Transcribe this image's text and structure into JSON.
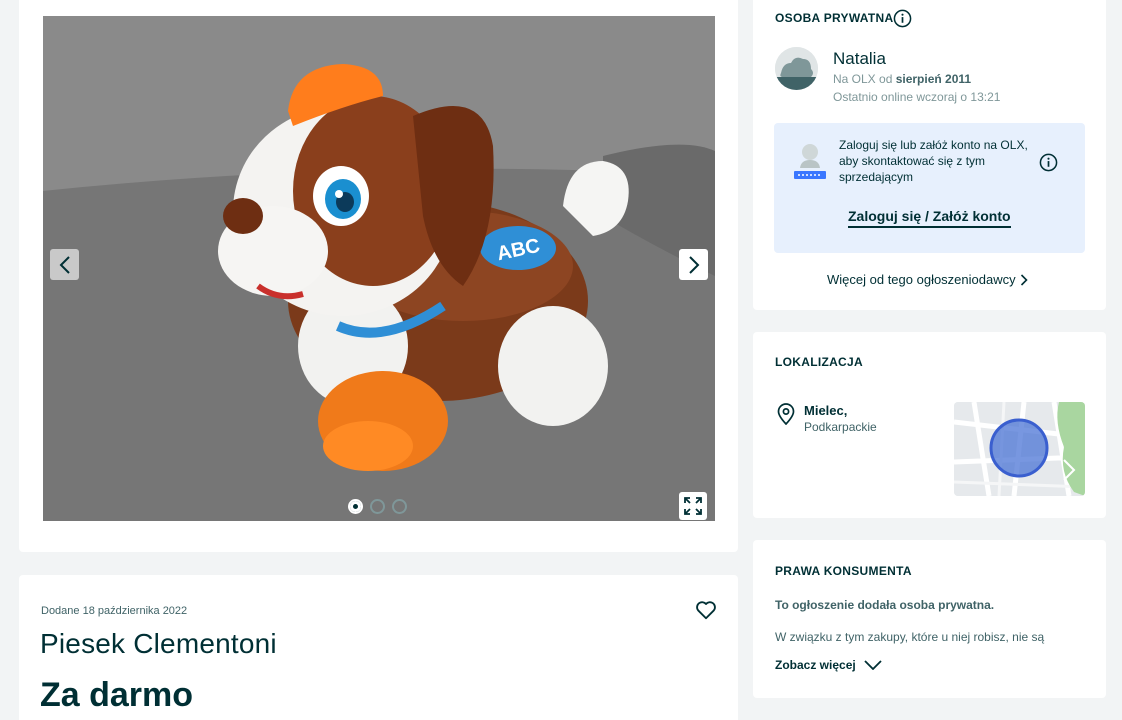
{
  "gallery": {
    "image_alt": "toy-dog-photo",
    "slide_count": 3,
    "active_slide": 1,
    "photo_badge_text": "ABC",
    "icons": {
      "prev": "chevron-left-icon",
      "next": "chevron-right-icon",
      "fullscreen": "expand-icon"
    }
  },
  "ad": {
    "added_date": "Dodane 18 października 2022",
    "title": "Piesek Clementoni",
    "price": "Za darmo",
    "favorite_icon": "heart-outline-icon"
  },
  "seller": {
    "heading": "OSOBA PRYWATNA",
    "name": "Natalia",
    "since_prefix": "Na OLX od ",
    "since_value": "sierpień 2011",
    "last_online": "Ostatnio online wczoraj o 13:21",
    "login_prompt": "Zaloguj się lub załóż konto na OLX, aby skontaktować się z tym sprzedającym",
    "login_link": "Zaloguj się / Załóż konto",
    "more_from_seller": "Więcej od tego ogłoszeniodawcy"
  },
  "location": {
    "heading": "LOKALIZACJA",
    "city": "Mielec,",
    "region": "Podkarpackie"
  },
  "consumer_rights": {
    "heading": "PRAWA KONSUMENTA",
    "lead": "To ogłoszenie dodała osoba prywatna.",
    "body": "W związku z tym zakupy, które u niej robisz, nie są",
    "see_more": "Zobacz więcej"
  },
  "colors": {
    "primary": "#002f34",
    "secondary_text": "#406367",
    "muted_text": "#7f9799",
    "info_box_bg": "#e7f0fd",
    "map_circle": "#4b74d6",
    "page_bg": "#f2f4f5"
  }
}
